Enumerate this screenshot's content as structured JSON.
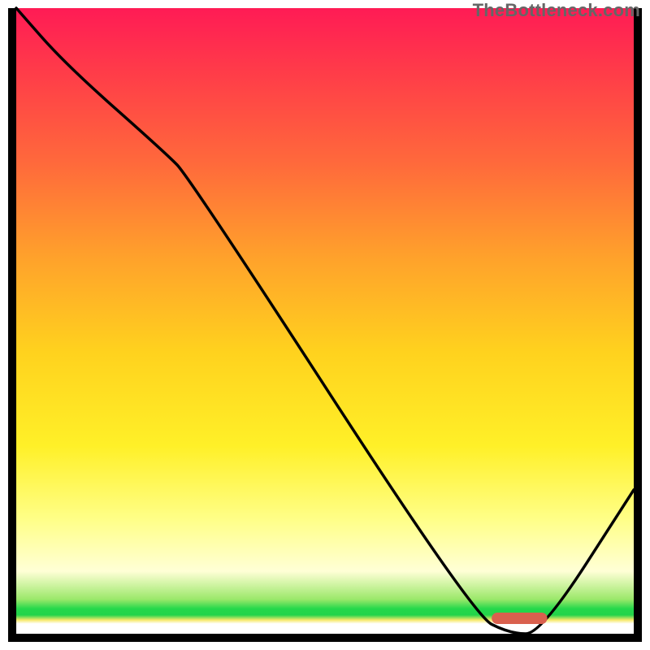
{
  "watermark": "TheBottleneck.com",
  "chart_data": {
    "type": "line",
    "title": "",
    "xlabel": "",
    "ylabel": "",
    "xlim": [
      0,
      100
    ],
    "ylim": [
      0,
      100
    ],
    "grid": false,
    "series": [
      {
        "name": "bottleneck-curve",
        "x": [
          0,
          8,
          24,
          28,
          74,
          80,
          85,
          100
        ],
        "values": [
          100,
          91,
          77,
          73,
          3,
          0,
          0,
          23
        ]
      }
    ],
    "marker": {
      "name": "optimal-range",
      "x_start": 77,
      "x_end": 86,
      "y": 0,
      "color": "#d9604e"
    },
    "background_gradient": {
      "direction": "vertical",
      "stops": [
        {
          "pos": 0.0,
          "color": "#ff1b55"
        },
        {
          "pos": 0.25,
          "color": "#ff6a3b"
        },
        {
          "pos": 0.55,
          "color": "#ffd21e"
        },
        {
          "pos": 0.82,
          "color": "#ffff8a"
        },
        {
          "pos": 0.96,
          "color": "#25d84b"
        },
        {
          "pos": 0.98,
          "color": "#f6e96a"
        },
        {
          "pos": 1.0,
          "color": "#ffffff"
        }
      ]
    }
  }
}
